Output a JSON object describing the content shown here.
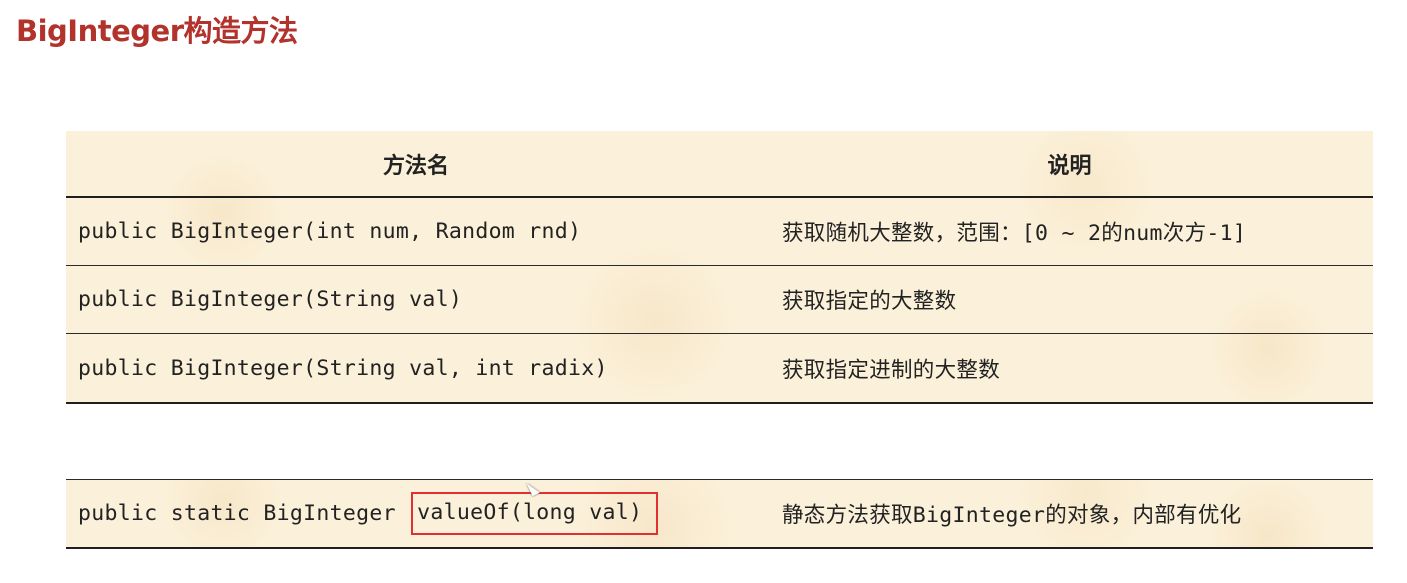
{
  "page": {
    "title": "BigInteger构造方法"
  },
  "table": {
    "headers": {
      "method": "方法名",
      "description": "说明"
    },
    "rows": [
      {
        "method": "public BigInteger(int num, Random rnd)",
        "description": "获取随机大整数，范围：[0 ~ 2的num次方-1]"
      },
      {
        "method": "public BigInteger(String val)",
        "description": "获取指定的大整数"
      },
      {
        "method": "public BigInteger(String val, int radix)",
        "description": "获取指定进制的大整数"
      }
    ]
  },
  "static_table": {
    "rows": [
      {
        "method_prefix": "public static BigInteger ",
        "method_highlight": "valueOf(long val)",
        "description": "静态方法获取BigInteger的对象，内部有优化"
      }
    ]
  },
  "colors": {
    "title": "#b2322c",
    "table_background": "#fbf0d9",
    "highlight_border": "#e03030",
    "rule": "#1f1f1f"
  },
  "icons": {
    "cursor": "mouse-pointer-icon"
  }
}
